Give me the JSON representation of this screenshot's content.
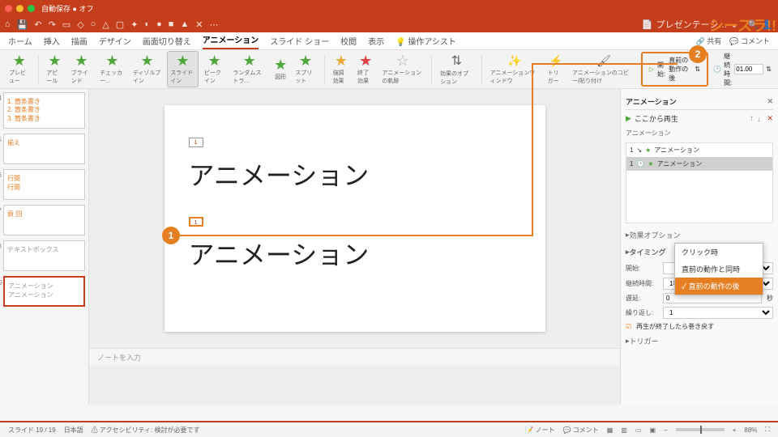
{
  "brand": "シースラ!!",
  "titlebar": {
    "autosave_label": "自動保存",
    "autosave_state": "● オフ",
    "doc_icon": "📄",
    "doc_title": "プレゼンテーシ…"
  },
  "tabs": {
    "items": [
      "ホーム",
      "挿入",
      "描画",
      "デザイン",
      "画面切り替え",
      "アニメーション",
      "スライド ショー",
      "校閲",
      "表示"
    ],
    "assist": "操作アシスト",
    "active": "アニメーション",
    "share": "共有",
    "comment": "コメント"
  },
  "ribbon": {
    "preview": "プレビュー",
    "effects": [
      {
        "label": "アピール",
        "color": "green"
      },
      {
        "label": "ブラインド",
        "color": "green"
      },
      {
        "label": "チェッカー…",
        "color": "green"
      },
      {
        "label": "ディゾルブイン",
        "color": "green"
      },
      {
        "label": "スライドイン",
        "color": "green",
        "active": true
      },
      {
        "label": "ピークイン",
        "color": "green"
      },
      {
        "label": "ランダムストラ…",
        "color": "green"
      },
      {
        "label": "図形",
        "color": "green"
      },
      {
        "label": "スプリット",
        "color": "green"
      }
    ],
    "groups": [
      {
        "label": "強調効果",
        "color": "yellow"
      },
      {
        "label": "終了効果",
        "color": "red"
      },
      {
        "label": "アニメーションの軌跡",
        "color": "gray"
      }
    ],
    "options": "効果のオプション",
    "reorder": "アニメーションウィンドウ",
    "trigger": "トリガー",
    "copy": "アニメーションのコピー/貼り付け",
    "start_label": "開始:",
    "start_value": "直前の動作の後",
    "duration_label": "継続時間:",
    "duration_value": "01.00"
  },
  "thumbs": [
    {
      "num": "14",
      "lines": [
        "1. 箇条書き",
        "2. 箇条書き",
        "3. 箇条書き"
      ]
    },
    {
      "num": "15",
      "lines": [
        "揃え"
      ]
    },
    {
      "num": "16",
      "lines": [
        "行間",
        "行間"
      ]
    },
    {
      "num": "17",
      "lines": [
        "貢 回"
      ]
    },
    {
      "num": "18",
      "lines": [
        "テキストボックス"
      ],
      "gray": true
    },
    {
      "num": "19",
      "lines": [
        "アニメーション",
        "アニメーション"
      ],
      "gray": true,
      "sel": true
    }
  ],
  "slide": {
    "marker1": "1",
    "marker2": "1",
    "text1": "アニメーション",
    "text2": "アニメーション"
  },
  "notes_placeholder": "ノートを入力",
  "anim_panel": {
    "title": "アニメーション",
    "play_from": "ここから再生",
    "section": "アニメーション",
    "items": [
      {
        "idx": "1",
        "icon": "★",
        "name": "アニメーション",
        "color": "#4da839"
      },
      {
        "idx": "1",
        "icon": "🕐",
        "name": "アニメーション",
        "sel": true,
        "color": "#4da839"
      }
    ],
    "effect_opts": "効果オプション",
    "timing_hdr": "タイミング",
    "start": "開始:",
    "dur": "継続時間:",
    "dur_val": "1秒(速く)",
    "delay": "遅延:",
    "delay_val": "0",
    "delay_unit": "秒",
    "repeat": "繰り返し:",
    "repeat_val": "1",
    "rewind": "再生が終了したら巻き戻す",
    "trigger": "トリガー"
  },
  "popup": {
    "items": [
      "クリック時",
      "直前の動作と同時",
      "直前の動作の後"
    ],
    "selected": "直前の動作の後"
  },
  "status": {
    "slide": "スライド 19 / 19",
    "lang": "日本語",
    "a11y": "アクセシビリティ: 検討が必要です",
    "notes": "ノート",
    "comments": "コメント",
    "zoom": "88%"
  },
  "callouts": {
    "c1": "1",
    "c2": "2"
  }
}
